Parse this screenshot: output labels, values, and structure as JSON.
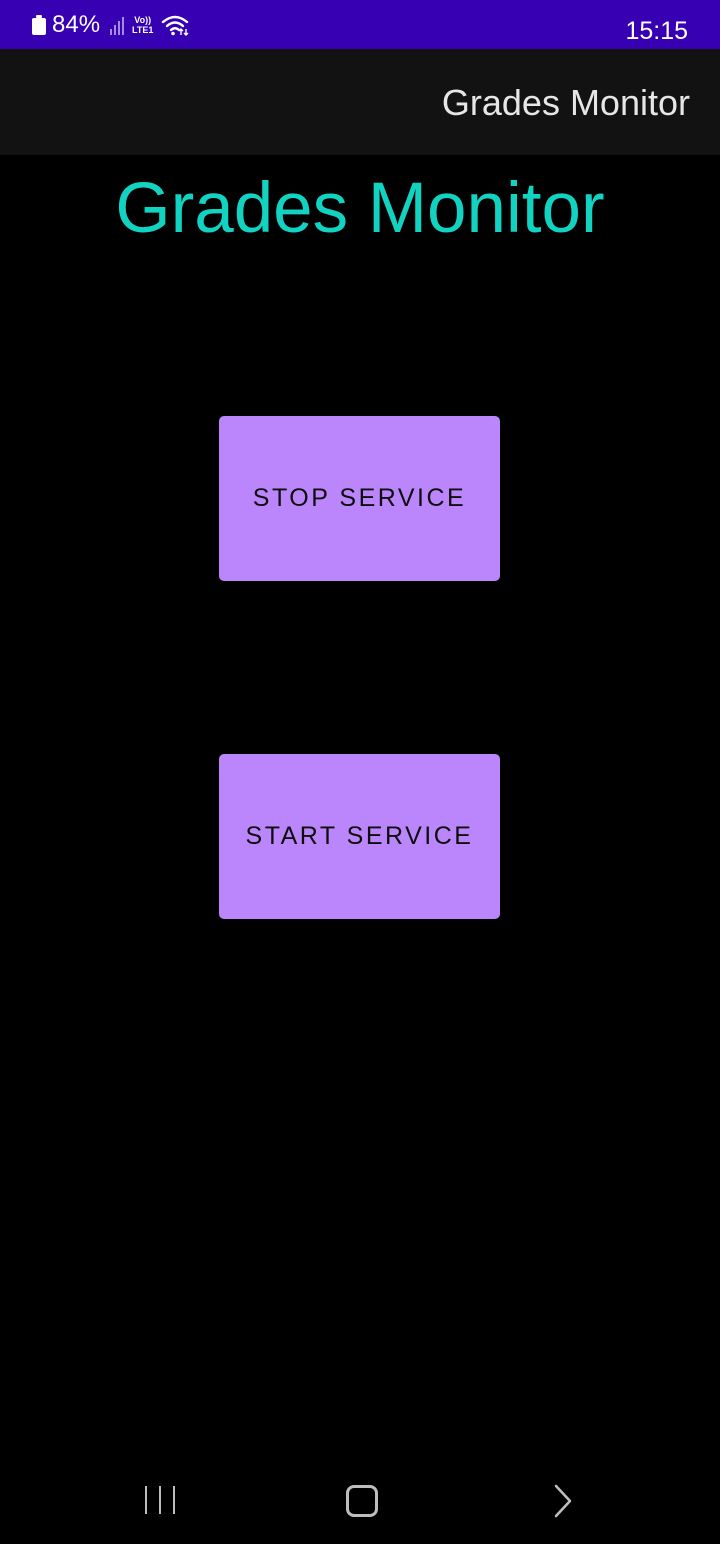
{
  "status_bar": {
    "battery": "84%",
    "network": "LTE1",
    "volte": "Vo))",
    "time": "15:15",
    "background": "#3700B3"
  },
  "app_bar": {
    "title": "Grades Monitor"
  },
  "main": {
    "heading": "Grades Monitor",
    "heading_color": "#12D3C1",
    "stop_button_label": "STOP SERVICE",
    "start_button_label": "START SERVICE",
    "button_color": "#BB86FC"
  },
  "nav_bar": {
    "icons": [
      "recents-icon",
      "home-icon",
      "back-icon"
    ]
  }
}
